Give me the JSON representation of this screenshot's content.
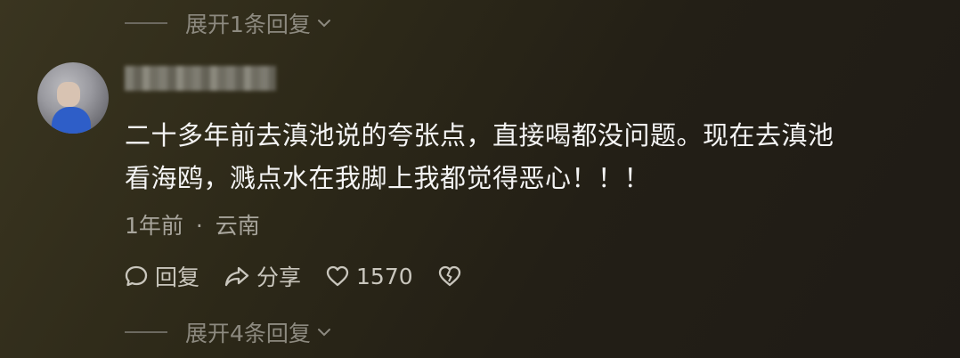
{
  "replies_top": {
    "label": "展开1条回复"
  },
  "comment": {
    "text_line1": "二十多年前去滇池说的夸张点，直接喝都没问题。现在去滇池",
    "text_line2": "看海鸥，溅点水在我脚上我都觉得恶心！！！",
    "time": "1年前",
    "separator": "·",
    "location": "云南"
  },
  "actions": {
    "reply_label": "回复",
    "share_label": "分享",
    "like_count": "1570"
  },
  "replies_bottom": {
    "label": "展开4条回复"
  },
  "icons": {
    "reply": "comment-bubble-icon",
    "share": "share-arrow-icon",
    "like": "heart-icon",
    "dislike": "broken-heart-icon",
    "expand": "chevron-down-icon"
  }
}
